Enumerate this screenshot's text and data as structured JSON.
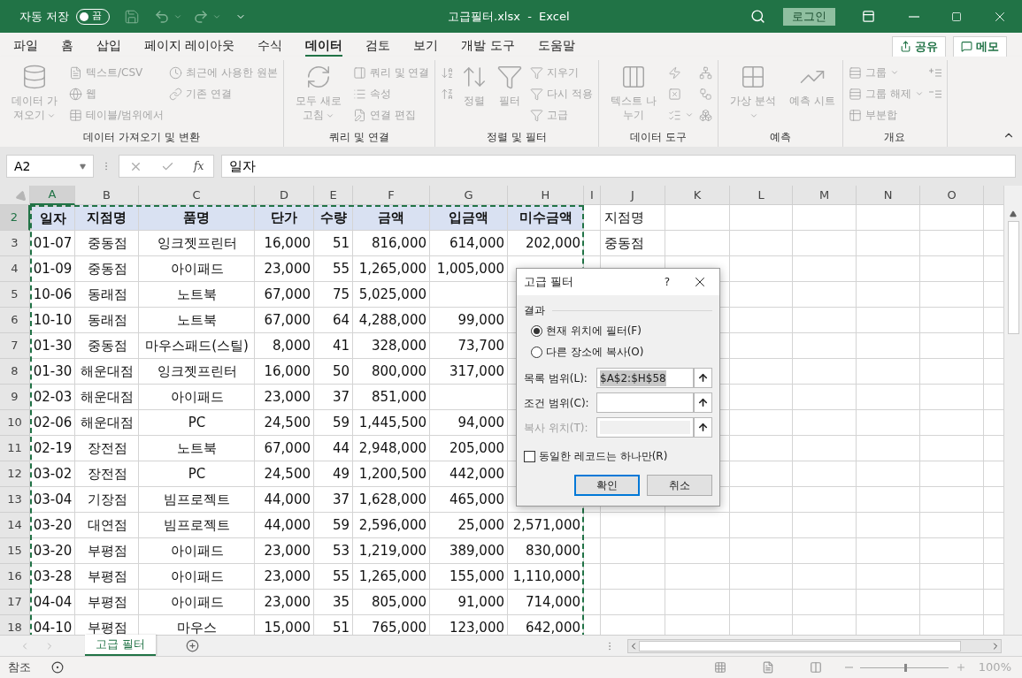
{
  "title_bar": {
    "autosave": {
      "label": "자동 저장",
      "state": "끔",
      "on": false
    },
    "title": "고급필터.xlsx  -  Excel",
    "login": "로그인"
  },
  "menu_tabs": [
    {
      "label": "파일",
      "selected": false
    },
    {
      "label": "홈",
      "selected": false
    },
    {
      "label": "삽입",
      "selected": false
    },
    {
      "label": "페이지 레이아웃",
      "selected": false
    },
    {
      "label": "수식",
      "selected": false
    },
    {
      "label": "데이터",
      "selected": true
    },
    {
      "label": "검토",
      "selected": false
    },
    {
      "label": "보기",
      "selected": false
    },
    {
      "label": "개발 도구",
      "selected": false
    },
    {
      "label": "도움말",
      "selected": false
    }
  ],
  "share_button": "공유",
  "comments_button": "메모",
  "ribbon": {
    "disabled": true,
    "groups": [
      {
        "label": "데이터 가져오기 및 변환",
        "items": [
          {
            "kind": "large",
            "label": "데이터 가져오기",
            "dropdown": true
          },
          {
            "kind": "small",
            "label": "텍스트/CSV"
          },
          {
            "kind": "small",
            "label": "웹"
          },
          {
            "kind": "small",
            "label": "테이블/범위에서"
          },
          {
            "kind": "small",
            "label": "최근에 사용한 원본"
          },
          {
            "kind": "small",
            "label": "기존 연결"
          }
        ]
      },
      {
        "label": "쿼리 및 연결",
        "items": [
          {
            "kind": "large",
            "label": "모두 새로 고침",
            "dropdown": true
          },
          {
            "kind": "small",
            "label": "쿼리 및 연결"
          },
          {
            "kind": "small",
            "label": "속성"
          },
          {
            "kind": "small",
            "label": "연결 편집"
          }
        ]
      },
      {
        "label": "정렬 및 필터",
        "items": [
          {
            "kind": "icon"
          },
          {
            "kind": "icon"
          },
          {
            "kind": "large",
            "label": "정렬"
          },
          {
            "kind": "large",
            "label": "필터"
          },
          {
            "kind": "small",
            "label": "지우기"
          },
          {
            "kind": "small",
            "label": "다시 적용"
          },
          {
            "kind": "small",
            "label": "고급"
          }
        ]
      },
      {
        "label": "데이터 도구",
        "items": [
          {
            "kind": "large",
            "label": "텍스트 나누기"
          },
          {
            "kind": "icon"
          },
          {
            "kind": "icon"
          },
          {
            "kind": "icon",
            "dropdown": true
          },
          {
            "kind": "icon"
          },
          {
            "kind": "icon"
          },
          {
            "kind": "icon"
          }
        ]
      },
      {
        "label": "예측",
        "items": [
          {
            "kind": "large",
            "label": "가상 분석",
            "dropdown": true
          },
          {
            "kind": "large",
            "label": "예측 시트"
          }
        ]
      },
      {
        "label": "개요",
        "items": [
          {
            "kind": "small",
            "label": "그룹",
            "dropdown": true
          },
          {
            "kind": "small",
            "label": "그룹 해제",
            "dropdown": true
          },
          {
            "kind": "small",
            "label": "부분합"
          },
          {
            "kind": "icon"
          },
          {
            "kind": "icon"
          }
        ]
      }
    ]
  },
  "formula_bar": {
    "name_box": "A2",
    "function_label": "fx",
    "value": "일자"
  },
  "columns": [
    {
      "label": "A",
      "selected": true
    },
    {
      "label": "B",
      "selected": false
    },
    {
      "label": "C",
      "selected": false
    },
    {
      "label": "D",
      "selected": false
    },
    {
      "label": "E",
      "selected": false
    },
    {
      "label": "F",
      "selected": false
    },
    {
      "label": "G",
      "selected": false
    },
    {
      "label": "H",
      "selected": false
    },
    {
      "label": "I",
      "selected": false
    },
    {
      "label": "J",
      "selected": false
    },
    {
      "label": "K",
      "selected": false
    },
    {
      "label": "L",
      "selected": false
    },
    {
      "label": "M",
      "selected": false
    },
    {
      "label": "N",
      "selected": false
    },
    {
      "label": "O",
      "selected": false
    }
  ],
  "rows": [
    {
      "number": "2",
      "selected": true,
      "kind": "header",
      "cells": [
        "일자",
        "지점명",
        "품명",
        "단가",
        "수량",
        "금액",
        "입금액",
        "미수금액",
        null,
        "지점명"
      ]
    },
    {
      "number": "3",
      "selected": false,
      "kind": "data",
      "cells": [
        "01-07",
        "중동점",
        "잉크젯프린터",
        "16,000",
        "51",
        "816,000",
        "614,000",
        "202,000",
        null,
        "중동점"
      ]
    },
    {
      "number": "4",
      "selected": false,
      "kind": "data",
      "cells": [
        "01-09",
        "중동점",
        "아이패드",
        "23,000",
        "55",
        "1,265,000",
        "1,005,000"
      ]
    },
    {
      "number": "5",
      "selected": false,
      "kind": "data",
      "cells": [
        "10-06",
        "동래점",
        "노트북",
        "67,000",
        "75",
        "5,025,000"
      ]
    },
    {
      "number": "6",
      "selected": false,
      "kind": "data",
      "cells": [
        "10-10",
        "동래점",
        "노트북",
        "67,000",
        "64",
        "4,288,000",
        "99,000"
      ]
    },
    {
      "number": "7",
      "selected": false,
      "kind": "data",
      "cells": [
        "01-30",
        "중동점",
        "마우스패드(스틸)",
        "8,000",
        "41",
        "328,000",
        "73,700"
      ]
    },
    {
      "number": "8",
      "selected": false,
      "kind": "data",
      "cells": [
        "01-30",
        "해운대점",
        "잉크젯프린터",
        "16,000",
        "50",
        "800,000",
        "317,000"
      ]
    },
    {
      "number": "9",
      "selected": false,
      "kind": "data",
      "cells": [
        "02-03",
        "해운대점",
        "아이패드",
        "23,000",
        "37",
        "851,000"
      ]
    },
    {
      "number": "10",
      "selected": false,
      "kind": "data",
      "cells": [
        "02-06",
        "해운대점",
        "PC",
        "24,500",
        "59",
        "1,445,500",
        "94,000"
      ]
    },
    {
      "number": "11",
      "selected": false,
      "kind": "data",
      "cells": [
        "02-19",
        "장전점",
        "노트북",
        "67,000",
        "44",
        "2,948,000",
        "205,000"
      ]
    },
    {
      "number": "12",
      "selected": false,
      "kind": "data",
      "cells": [
        "03-02",
        "장전점",
        "PC",
        "24,500",
        "49",
        "1,200,500",
        "442,000"
      ]
    },
    {
      "number": "13",
      "selected": false,
      "kind": "data",
      "cells": [
        "03-04",
        "기장점",
        "빔프로젝트",
        "44,000",
        "37",
        "1,628,000",
        "465,000"
      ]
    },
    {
      "number": "14",
      "selected": false,
      "kind": "data",
      "cells": [
        "03-20",
        "대연점",
        "빔프로젝트",
        "44,000",
        "59",
        "2,596,000",
        "25,000",
        "2,571,000"
      ]
    },
    {
      "number": "15",
      "selected": false,
      "kind": "data",
      "cells": [
        "03-20",
        "부평점",
        "아이패드",
        "23,000",
        "53",
        "1,219,000",
        "389,000",
        "830,000"
      ]
    },
    {
      "number": "16",
      "selected": false,
      "kind": "data",
      "cells": [
        "03-28",
        "부평점",
        "아이패드",
        "23,000",
        "55",
        "1,265,000",
        "155,000",
        "1,110,000"
      ]
    },
    {
      "number": "17",
      "selected": false,
      "kind": "data",
      "cells": [
        "04-04",
        "부평점",
        "아이패드",
        "23,000",
        "35",
        "805,000",
        "91,000",
        "714,000"
      ]
    },
    {
      "number": "18",
      "selected": false,
      "kind": "data",
      "cells": [
        "04-10",
        "부평점",
        "마우스",
        "15,000",
        "51",
        "765,000",
        "123,000",
        "642,000"
      ]
    }
  ],
  "sheet_tabs": [
    {
      "label": "고급 필터",
      "selected": true
    }
  ],
  "status_bar": {
    "mode": "참조",
    "zoom": {
      "level": 0.5,
      "reading": "100%"
    }
  },
  "dialog": {
    "title": "고급 필터",
    "help": "?",
    "section": "결과",
    "options": [
      {
        "label": "현재 위치에 필터(F)",
        "selected": true
      },
      {
        "label": "다른 장소에 복사(O)",
        "selected": false
      }
    ],
    "fields": [
      {
        "label": "목록 범위(L):",
        "value": "$A$2:$H$58",
        "disabled": false
      },
      {
        "label": "조건 범위(C):",
        "disabled": false
      },
      {
        "label": "복사 위치(T):",
        "disabled": true
      }
    ],
    "unique": {
      "label": "동일한 레코드는 하나만(R)",
      "checked": false
    },
    "buttons": [
      {
        "label": "확인",
        "default": true
      },
      {
        "label": "취소",
        "default": false
      }
    ]
  }
}
